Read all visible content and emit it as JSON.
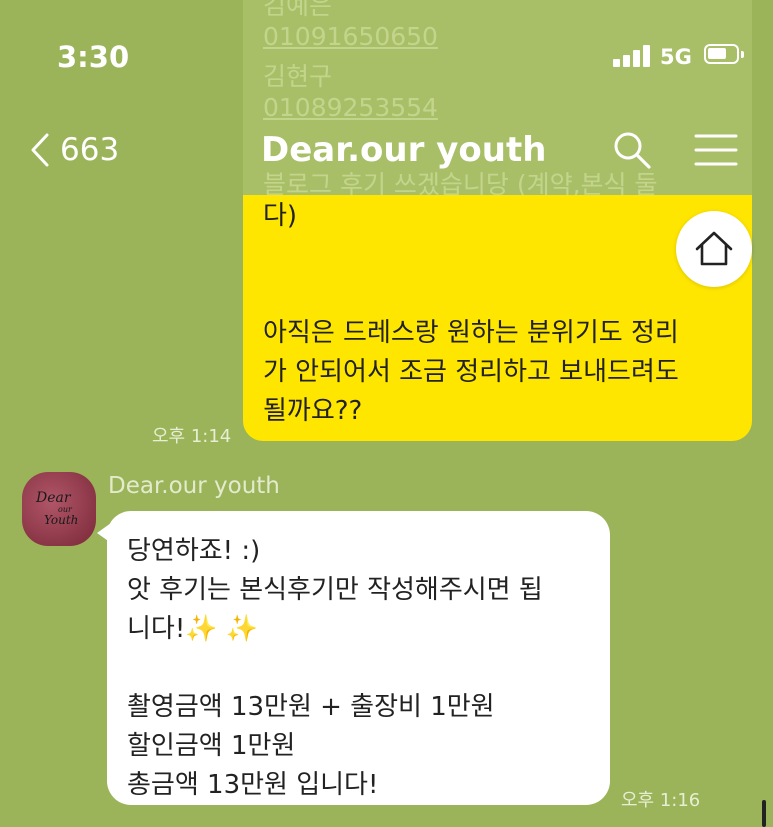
{
  "status_bar": {
    "time": "3:30",
    "network": "5G"
  },
  "background_messages": {
    "lines": [
      {
        "text": "김예은",
        "phone": false
      },
      {
        "text": "01091650650",
        "phone": true
      },
      {
        "text": "김현구",
        "phone": false
      },
      {
        "text": "01089253554",
        "phone": true
      },
      {
        "text": "블로그 후기 쓰겠습니당 (계약,본식 둘",
        "phone": false
      }
    ]
  },
  "header": {
    "back_count": "663",
    "title": "Dear.our youth"
  },
  "outgoing_message": {
    "line1": "다)",
    "line2": "아직은 드레스랑 원하는 분위기도 정리",
    "line3": "가 안되어서 조금 정리하고 보내드려도",
    "line4": "될까요??",
    "time": "오후 1:14"
  },
  "incoming_message": {
    "sender": "Dear.our youth",
    "avatar_text": "Dear our Youth",
    "line1": "당연하죠! :)",
    "line2": "앗 후기는 본식후기만 작성해주시면 됩",
    "line3": "니다!",
    "sparkles": "✨ ✨",
    "line4": "촬영금액 13만원 + 출장비 1만원",
    "line5": "할인금액 1만원",
    "line6": "총금액 13만원 입니다!",
    "time": "오후 1:16"
  },
  "colors": {
    "background": "#9bb45a",
    "outgoing_bubble": "#ffe600",
    "incoming_bubble": "#ffffff"
  }
}
